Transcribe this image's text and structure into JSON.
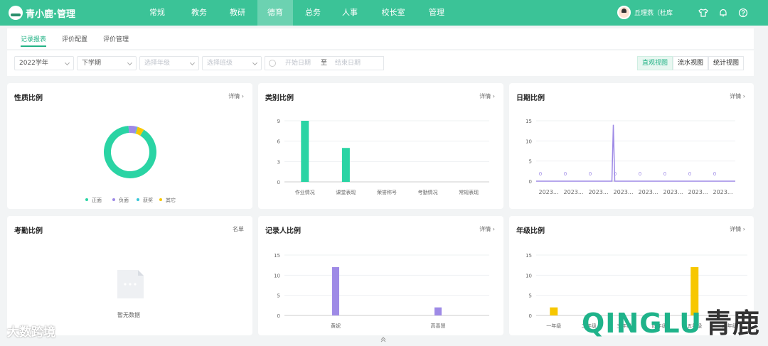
{
  "app": {
    "brand": "青小鹿·管理"
  },
  "nav": {
    "items": [
      "常规",
      "教务",
      "教研",
      "德育",
      "总务",
      "人事",
      "校长室",
      "管理"
    ],
    "active_index": 3
  },
  "user": {
    "name": "丘理燕（杜库"
  },
  "tabs": {
    "items": [
      "记录报表",
      "评价配置",
      "评价管理"
    ],
    "active_index": 0
  },
  "filters": {
    "year": "2022学年",
    "term": "下学期",
    "grade_placeholder": "选择年级",
    "class_placeholder": "选择班级",
    "start_placeholder": "开始日期",
    "separator": "至",
    "end_placeholder": "结束日期"
  },
  "views": {
    "items": [
      "直观视图",
      "流水视图",
      "统计视图"
    ],
    "active_index": 0
  },
  "cards": {
    "nature": {
      "title": "性质比例",
      "link": "详情"
    },
    "category": {
      "title": "类别比例",
      "link": "详情"
    },
    "date": {
      "title": "日期比例",
      "link": "详情"
    },
    "attendance": {
      "title": "考勤比例",
      "link": "名单",
      "empty": "暂无数据"
    },
    "recorder": {
      "title": "记录人比例",
      "link": "详情"
    },
    "grade": {
      "title": "年级比例",
      "link": "详情"
    }
  },
  "colors": {
    "brand": "#3bc397",
    "green": "#2ad4a4",
    "purple": "#9e8ae6",
    "teal": "#36c6d8",
    "yellow": "#f7c700"
  },
  "chart_data": [
    {
      "id": "nature",
      "type": "pie",
      "labels": [
        "正面",
        "负面",
        "获奖",
        "其它"
      ],
      "values": [
        88,
        5,
        0.5,
        4
      ],
      "legend_position": "bottom"
    },
    {
      "id": "category",
      "type": "bar",
      "categories": [
        "作业情况",
        "课堂表现",
        "荣誉称号",
        "考勤情况",
        "常规表现"
      ],
      "values": [
        9,
        5,
        0,
        0,
        0
      ],
      "ylim": [
        0,
        9
      ],
      "yticks": [
        0,
        3,
        6,
        9
      ]
    },
    {
      "id": "date",
      "type": "line",
      "x_tick_labels": [
        "2023...",
        "2023...",
        "2023...",
        "2023...",
        "2023...",
        "2023...",
        "2023...",
        "2023..."
      ],
      "point_labels": [
        "0",
        "0",
        "0",
        "0",
        "0",
        "0",
        "0",
        "0"
      ],
      "peak_value": 14,
      "ylim": [
        0,
        15
      ],
      "yticks": [
        0,
        5,
        10,
        15
      ]
    },
    {
      "id": "recorder",
      "type": "bar",
      "categories": [
        "黄妮",
        "高喜慧"
      ],
      "values": [
        12,
        2
      ],
      "ylim": [
        0,
        15
      ],
      "yticks": [
        0,
        5,
        10,
        15
      ]
    },
    {
      "id": "grade",
      "type": "bar",
      "categories": [
        "一年级",
        "二年级",
        "三年级",
        "四年级",
        "五年级",
        "六年级"
      ],
      "values": [
        2,
        0,
        0,
        0,
        12,
        0
      ],
      "ylim": [
        0,
        15
      ],
      "yticks": [
        0,
        5,
        10,
        15
      ]
    }
  ],
  "watermarks": {
    "left": "大数跨境",
    "right_latin": "QINGLU",
    "right_cn": "青鹿"
  }
}
